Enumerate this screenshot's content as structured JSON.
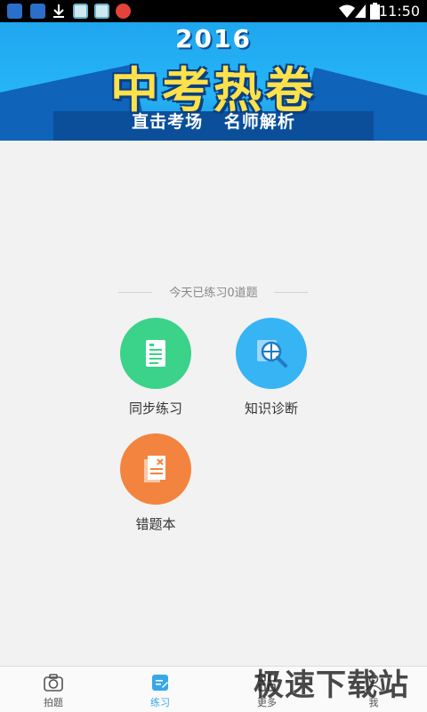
{
  "status_bar": {
    "time": "11:50",
    "icons": [
      "app-notification-icon",
      "app-notification-icon",
      "download-icon",
      "app-icon",
      "app-icon",
      "app-icon",
      "wifi-icon",
      "signal-icon",
      "battery-icon"
    ]
  },
  "banner": {
    "year": "2016",
    "title": "中考热卷",
    "subtitle_left": "直击考场",
    "subtitle_right": "名师解析"
  },
  "summary": {
    "text": "今天已练习0道题"
  },
  "features": {
    "sync": {
      "label": "同步练习",
      "icon": "document-icon",
      "color": "#3bd28a"
    },
    "diagnosis": {
      "label": "知识诊断",
      "icon": "magnifier-icon",
      "color": "#36b4f4"
    },
    "wrong_book": {
      "label": "错题本",
      "icon": "wrong-book-icon",
      "color": "#f3843f"
    }
  },
  "bottom_nav": {
    "items": [
      {
        "label": "拍题",
        "icon": "camera-icon"
      },
      {
        "label": "练习",
        "icon": "edit-icon",
        "active": true
      },
      {
        "label": "更多",
        "icon": "grid-icon"
      },
      {
        "label": "我",
        "icon": "user-icon"
      }
    ],
    "active_color": "#36a8ea"
  },
  "watermark": {
    "text": "极速下载站"
  }
}
